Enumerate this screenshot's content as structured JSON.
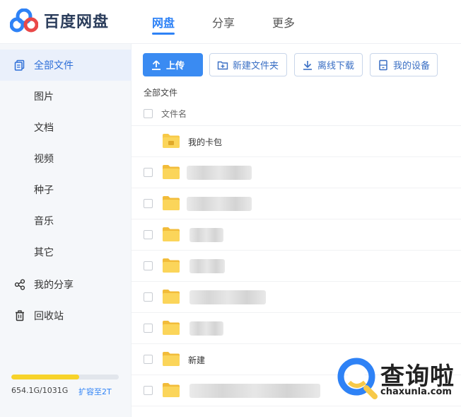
{
  "header": {
    "logo_text": "百度网盘",
    "tabs": [
      {
        "label": "网盘",
        "active": true
      },
      {
        "label": "分享",
        "active": false
      },
      {
        "label": "更多",
        "active": false
      }
    ]
  },
  "sidebar": {
    "items": [
      {
        "label": "全部文件",
        "icon": "file-copy-icon",
        "active": true
      },
      {
        "label": "图片",
        "icon": "",
        "active": false
      },
      {
        "label": "文档",
        "icon": "",
        "active": false
      },
      {
        "label": "视频",
        "icon": "",
        "active": false
      },
      {
        "label": "种子",
        "icon": "",
        "active": false
      },
      {
        "label": "音乐",
        "icon": "",
        "active": false
      },
      {
        "label": "其它",
        "icon": "",
        "active": false
      },
      {
        "label": "我的分享",
        "icon": "share-icon",
        "active": false
      },
      {
        "label": "回收站",
        "icon": "trash-icon",
        "active": false
      }
    ],
    "storage": {
      "text": "654.1G/1031G",
      "expand_label": "扩容至2T",
      "used_fraction": 0.634
    }
  },
  "toolbar": {
    "upload_label": "上传",
    "new_folder_label": "新建文件夹",
    "offline_download_label": "离线下载",
    "my_devices_label": "我的设备"
  },
  "breadcrumb": "全部文件",
  "table": {
    "column_name": "文件名",
    "rows": [
      {
        "name": "我的卡包",
        "blurred": false,
        "special": true
      },
      {
        "name": "",
        "blurred": true
      },
      {
        "name": "",
        "blurred": true
      },
      {
        "name": "",
        "blurred": true
      },
      {
        "name": "",
        "blurred": true
      },
      {
        "name": "",
        "blurred": true
      },
      {
        "name": "",
        "blurred": true
      },
      {
        "name": "新建",
        "blurred": false
      },
      {
        "name": "",
        "blurred": true
      }
    ]
  },
  "watermark": {
    "title": "查询啦",
    "subtitle": "chaxunla.com"
  },
  "colors": {
    "accent": "#2e82f6",
    "folder": "#f7c948",
    "storage_fill": "#f7d32a"
  }
}
